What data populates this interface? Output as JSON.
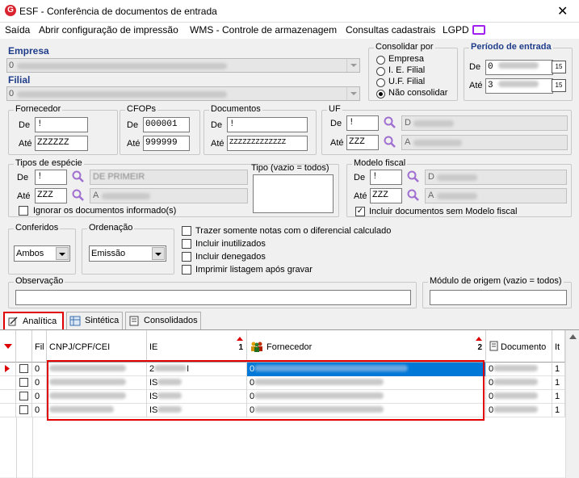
{
  "window": {
    "title": "ESF - Conferência de documentos de entrada",
    "close": "✕"
  },
  "menu": [
    "Saída",
    "Abrir configuração de impressão",
    "WMS - Controle de armazenagem",
    "Consultas cadastrais",
    "LGPD"
  ],
  "empresa": {
    "label": "Empresa",
    "value": "0"
  },
  "filial": {
    "label": "Filial",
    "value": "0"
  },
  "consolidar": {
    "title": "Consolidar por",
    "options": [
      "Empresa",
      "I. E. Filial",
      "U.F. Filial",
      "Não consolidar"
    ],
    "selected": "Não consolidar"
  },
  "periodo": {
    "title": "Período de entrada",
    "de_label": "De",
    "de_value": "0",
    "ate_label": "Até",
    "ate_value": "3",
    "cal_icon": "15"
  },
  "fornecedor": {
    "title": "Fornecedor",
    "de_label": "De",
    "de": "!",
    "ate_label": "Até",
    "ate": "ZZZZZZ"
  },
  "cfops": {
    "title": "CFOPs",
    "de_label": "De",
    "de": "000001",
    "ate_label": "Até",
    "ate": "999999"
  },
  "documentos": {
    "title": "Documentos",
    "de_label": "De",
    "de": "!",
    "ate_label": "Até",
    "ate": "ZZZZZZZZZZZZZ"
  },
  "uf": {
    "title": "UF",
    "de_label": "De",
    "de": "!",
    "de_desc": "D",
    "ate_label": "Até",
    "ate": "ZZZ",
    "ate_desc": "A"
  },
  "especie": {
    "title": "Tipos de espécie",
    "de_label": "De",
    "de": "!",
    "de_desc": "DE PRIMEIR",
    "ate_label": "Até",
    "ate": "ZZZ",
    "ate_desc": "A",
    "ignore": "Ignorar os documentos informado(s)"
  },
  "tipo": {
    "title": "Tipo (vazio = todos)"
  },
  "modelo": {
    "title": "Modelo fiscal",
    "de_label": "De",
    "de": "!",
    "de_desc": "D",
    "ate_label": "Até",
    "ate": "ZZZ",
    "ate_desc": "A",
    "incluir": "Incluir documentos sem Modelo fiscal"
  },
  "conferidos": {
    "title": "Conferidos",
    "value": "Ambos"
  },
  "ordenacao": {
    "title": "Ordenação",
    "value": "Emissão"
  },
  "options": [
    "Trazer somente notas com o diferencial calculado",
    "Incluir inutilizados",
    "Incluir denegados",
    "Imprimir listagem após gravar"
  ],
  "observacao": {
    "title": "Observação"
  },
  "modulo": {
    "title": "Módulo de origem (vazio = todos)"
  },
  "tabs": [
    "Analítica",
    "Sintética",
    "Consolidados"
  ],
  "grid": {
    "columns": [
      "Fil",
      "CNPJ/CPF/CEI",
      "IE",
      "Fornecedor",
      "Documento",
      "It"
    ],
    "sort_markers": [
      "1",
      "2"
    ],
    "rows": [
      {
        "fil": "0",
        "cnpj": "",
        "ie": "2",
        "fornecedor": "0",
        "doc": "0",
        "it": "1"
      },
      {
        "fil": "0",
        "cnpj": "",
        "ie": "IS",
        "fornecedor": "0",
        "doc": "0",
        "it": "1"
      },
      {
        "fil": "0",
        "cnpj": "",
        "ie": "IS",
        "fornecedor": "0",
        "doc": "0",
        "it": "1"
      },
      {
        "fil": "0",
        "cnpj": "",
        "ie": "IS",
        "fornecedor": "0",
        "doc": "0",
        "it": "1"
      }
    ]
  }
}
